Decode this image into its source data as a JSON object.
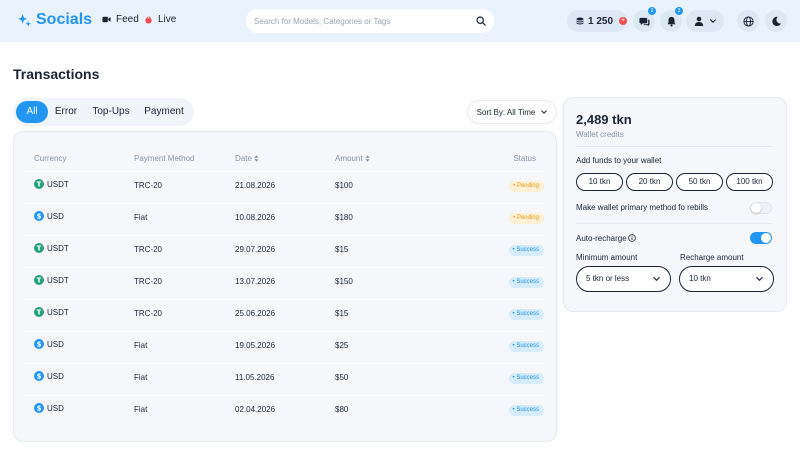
{
  "header": {
    "brand": "Socials",
    "nav": {
      "feed": "Feed",
      "live": "Live"
    },
    "search": {
      "placeholder": "Search for Models, Categories or Tags"
    },
    "balance": "1 250",
    "messages_badge": "2",
    "notifications_badge": "3"
  },
  "page": {
    "title": "Transactions"
  },
  "tabs": [
    {
      "label": "All",
      "active": true
    },
    {
      "label": "Error",
      "active": false
    },
    {
      "label": "Top-Ups",
      "active": false
    },
    {
      "label": "Payment",
      "active": false
    }
  ],
  "sort": {
    "label": "Sort By: All Time"
  },
  "table": {
    "columns": {
      "currency": "Currency",
      "method": "Payment Method",
      "date": "Date",
      "amount": "Amount",
      "status": "Status"
    },
    "rows": [
      {
        "currency": "USDT",
        "method": "TRC-20",
        "date": "21.08.2026",
        "amount": "$100",
        "status": "Pending",
        "status_type": "pending"
      },
      {
        "currency": "USD",
        "method": "Fiat",
        "date": "10.08.2026",
        "amount": "$180",
        "status": "Pending",
        "status_type": "pending"
      },
      {
        "currency": "USDT",
        "method": "TRC-20",
        "date": "29.07.2026",
        "amount": "$15",
        "status": "Success",
        "status_type": "success"
      },
      {
        "currency": "USDT",
        "method": "TRC-20",
        "date": "13.07.2026",
        "amount": "$150",
        "status": "Success",
        "status_type": "success"
      },
      {
        "currency": "USDT",
        "method": "TRC-20",
        "date": "25.06.2026",
        "amount": "$15",
        "status": "Success",
        "status_type": "success"
      },
      {
        "currency": "USD",
        "method": "Fiat",
        "date": "19.05.2026",
        "amount": "$25",
        "status": "Success",
        "status_type": "success"
      },
      {
        "currency": "USD",
        "method": "Fiat",
        "date": "11.05.2026",
        "amount": "$50",
        "status": "Success",
        "status_type": "success"
      },
      {
        "currency": "USD",
        "method": "Fiat",
        "date": "02.04.2026",
        "amount": "$80",
        "status": "Success",
        "status_type": "success"
      }
    ]
  },
  "wallet": {
    "amount": "2,489 tkn",
    "subtitle": "Wallet credits",
    "add_funds_label": "Add funds to your wallet",
    "amounts": [
      "10 tkn",
      "20 tkn",
      "50 tkn",
      "100 tkn"
    ],
    "primary_label": "Make wallet primary method fo rebills",
    "primary_enabled": false,
    "auto_recharge_label": "Auto-recharge",
    "auto_recharge_enabled": true,
    "min_amount_label": "Minimum amount",
    "min_amount_value": "5 tkn or less",
    "recharge_amount_label": "Recharge amount",
    "recharge_amount_value": "10 tkn"
  },
  "colors": {
    "accent": "#2196f3",
    "header_bg": "#eaf3fd",
    "usdt": "#26a17b",
    "usd": "#2196f3",
    "pending": "#e29a1b",
    "live": "#f0514f"
  }
}
